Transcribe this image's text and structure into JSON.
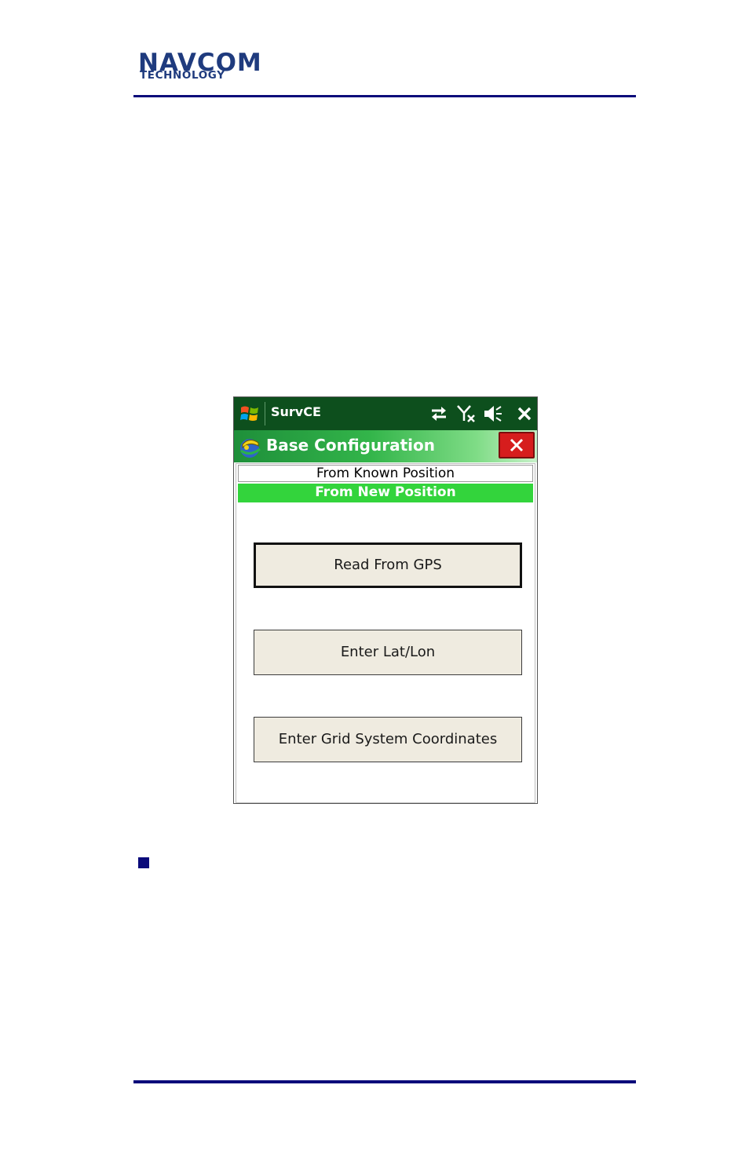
{
  "logo": {
    "line1": "NAVCOM",
    "line2": "TECHNOLOGY"
  },
  "taskbar": {
    "title": "SurvCE",
    "icons": [
      "windows-start-icon",
      "sync-arrows-icon",
      "no-signal-icon",
      "speaker-muted-icon",
      "close-icon"
    ]
  },
  "header": {
    "title": "Base Configuration",
    "close_icon": "close-icon",
    "app_icon": "survce-app-icon"
  },
  "tabs": {
    "known": "From Known Position",
    "new": "From New Position"
  },
  "buttons": {
    "read_gps": "Read From GPS",
    "enter_latlon": "Enter Lat/Lon",
    "enter_grid": "Enter Grid System Coordinates"
  },
  "colors": {
    "brand_navy": "#0a0a7a",
    "taskbar_green": "#0d4f1d",
    "active_tab": "#33d43c",
    "close_red": "#d61d1d"
  }
}
